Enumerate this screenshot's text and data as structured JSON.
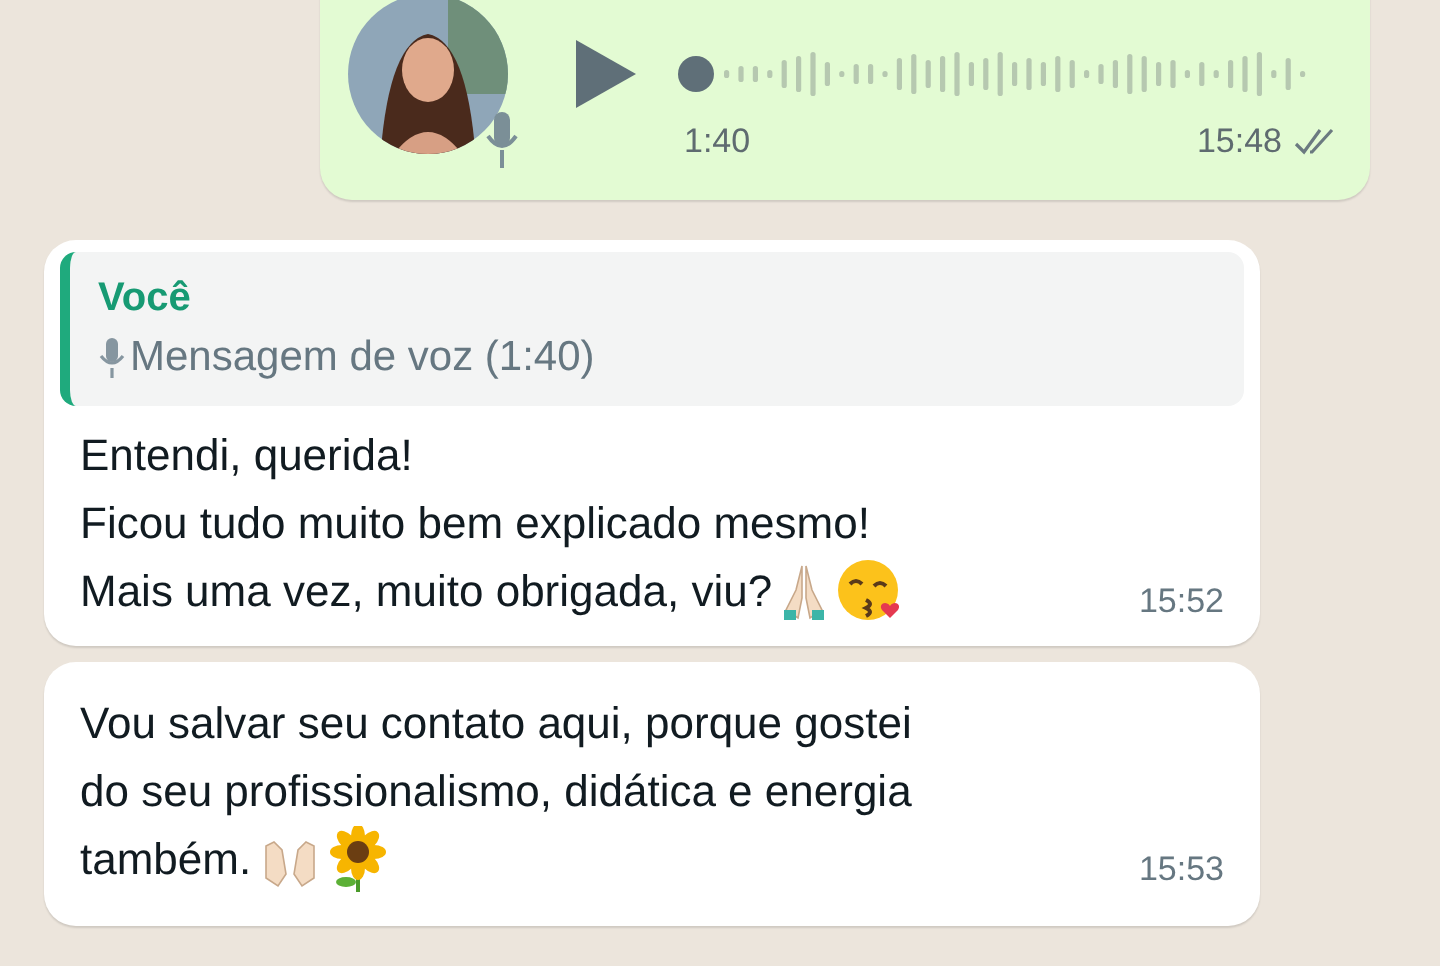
{
  "voice_message": {
    "duration": "1:40",
    "time": "15:48",
    "read": false
  },
  "messages": [
    {
      "quote": {
        "author": "Você",
        "text": "Mensagem de voz (1:40)"
      },
      "lines": [
        "Entendi, querida!",
        "Ficou tudo muito bem explicado mesmo!",
        "Mais uma vez, muito obrigada, viu?"
      ],
      "time": "15:52"
    },
    {
      "lines": [
        "Vou salvar seu contato aqui, porque gostei",
        "do seu profissionalismo, didática e energia",
        "também."
      ],
      "time": "15:53"
    }
  ]
}
